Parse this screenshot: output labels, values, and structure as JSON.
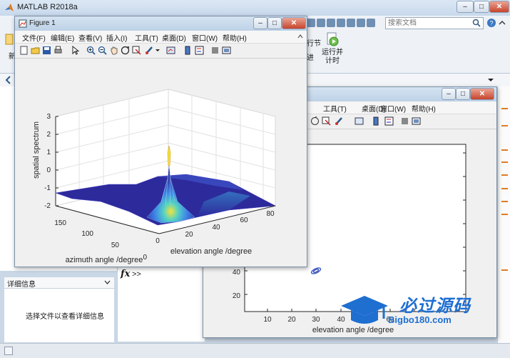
{
  "app": {
    "title": "MATLAB R2018a",
    "search_placeholder": "搜索文档"
  },
  "ribbon": {
    "run_section_partial": "行节",
    "advance_partial": "进",
    "run_and_time_label": "运行并\n计时",
    "new_partial": "新"
  },
  "left": {
    "details_header": "详细信息",
    "details_hint": "选择文件以查看详细信息",
    "fx_symbol": "fx",
    "prompt": ">>"
  },
  "figure1": {
    "title": "Figure 1",
    "menu": [
      "文件(F)",
      "编辑(E)",
      "查看(V)",
      "插入(I)",
      "工具(T)",
      "桌面(D)",
      "窗口(W)",
      "帮助(H)"
    ],
    "plot": {
      "zlabel": "spatial spectrum",
      "xlabel": "elevation angle /degree",
      "ylabel": "azimuth angle /degree",
      "z_ticks": [
        "3",
        "2",
        "1",
        "0",
        "-1",
        "-2"
      ],
      "x_ticks": [
        "0",
        "20",
        "40",
        "60",
        "80"
      ],
      "y_ticks": [
        "150",
        "100",
        "50",
        "0"
      ]
    }
  },
  "figure2": {
    "menu_visible": [
      "工具(T)",
      "桌面(D)",
      "窗口(W)",
      "帮助(H)"
    ],
    "plot": {
      "xlabel": "elevation angle  /degree",
      "x_ticks": [
        "10",
        "20",
        "30",
        "40",
        "50",
        "60"
      ],
      "y_ticks": [
        "40",
        "20"
      ]
    }
  },
  "watermark": {
    "text": "必过源码",
    "url": "Bigbo180.com"
  },
  "colors": {
    "surface_dark": "#2d2a9c",
    "surface_peak": "#f5e23a",
    "accent_orange": "#e07b22",
    "titlebar": "#c8d9ec"
  }
}
